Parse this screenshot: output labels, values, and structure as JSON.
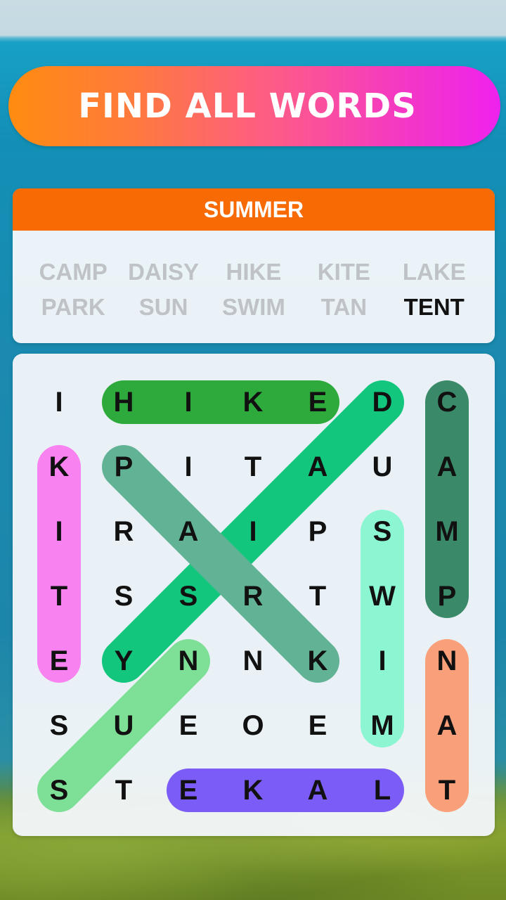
{
  "banner": {
    "title": "FIND ALL WORDS"
  },
  "word_list": {
    "category": "SUMMER",
    "words": [
      {
        "text": "CAMP",
        "found": true
      },
      {
        "text": "DAISY",
        "found": true
      },
      {
        "text": "HIKE",
        "found": true
      },
      {
        "text": "KITE",
        "found": true
      },
      {
        "text": "LAKE",
        "found": true
      },
      {
        "text": "PARK",
        "found": true
      },
      {
        "text": "SUN",
        "found": true
      },
      {
        "text": "SWIM",
        "found": true
      },
      {
        "text": "TAN",
        "found": true
      },
      {
        "text": "TENT",
        "found": false
      }
    ],
    "found_color": "#bfc2c6",
    "pending_color": "#111111"
  },
  "grid": {
    "rows": [
      [
        "I",
        "H",
        "I",
        "K",
        "E",
        "D",
        "C"
      ],
      [
        "K",
        "P",
        "I",
        "T",
        "A",
        "U",
        "A"
      ],
      [
        "I",
        "R",
        "A",
        "I",
        "P",
        "S",
        "M"
      ],
      [
        "T",
        "S",
        "S",
        "R",
        "T",
        "W",
        "P"
      ],
      [
        "E",
        "Y",
        "N",
        "N",
        "K",
        "I",
        "N"
      ],
      [
        "S",
        "U",
        "E",
        "O",
        "E",
        "M",
        "A"
      ],
      [
        "S",
        "T",
        "E",
        "K",
        "A",
        "L",
        "T"
      ]
    ],
    "found_words": [
      {
        "word": "DAISY",
        "start": [
          0,
          5
        ],
        "end": [
          4,
          1
        ],
        "color": "#12c67d"
      },
      {
        "word": "PARK",
        "start": [
          1,
          1
        ],
        "end": [
          4,
          4
        ],
        "color": "#62b396"
      },
      {
        "word": "HIKE",
        "start": [
          0,
          1
        ],
        "end": [
          0,
          4
        ],
        "color": "#2eaa3c"
      },
      {
        "word": "CAMP",
        "start": [
          0,
          6
        ],
        "end": [
          3,
          6
        ],
        "color": "#3a8a6a"
      },
      {
        "word": "KITE",
        "start": [
          1,
          0
        ],
        "end": [
          4,
          0
        ],
        "color": "#f882f0"
      },
      {
        "word": "SWIM",
        "start": [
          2,
          5
        ],
        "end": [
          5,
          5
        ],
        "color": "#8cf5d2"
      },
      {
        "word": "SUN",
        "start": [
          6,
          0
        ],
        "end": [
          4,
          2
        ],
        "color": "#7ee096"
      },
      {
        "word": "LAKE",
        "start": [
          6,
          5
        ],
        "end": [
          6,
          2
        ],
        "color": "#7c5cf6"
      },
      {
        "word": "TAN",
        "start": [
          6,
          6
        ],
        "end": [
          4,
          6
        ],
        "color": "#f9a07a"
      }
    ]
  }
}
